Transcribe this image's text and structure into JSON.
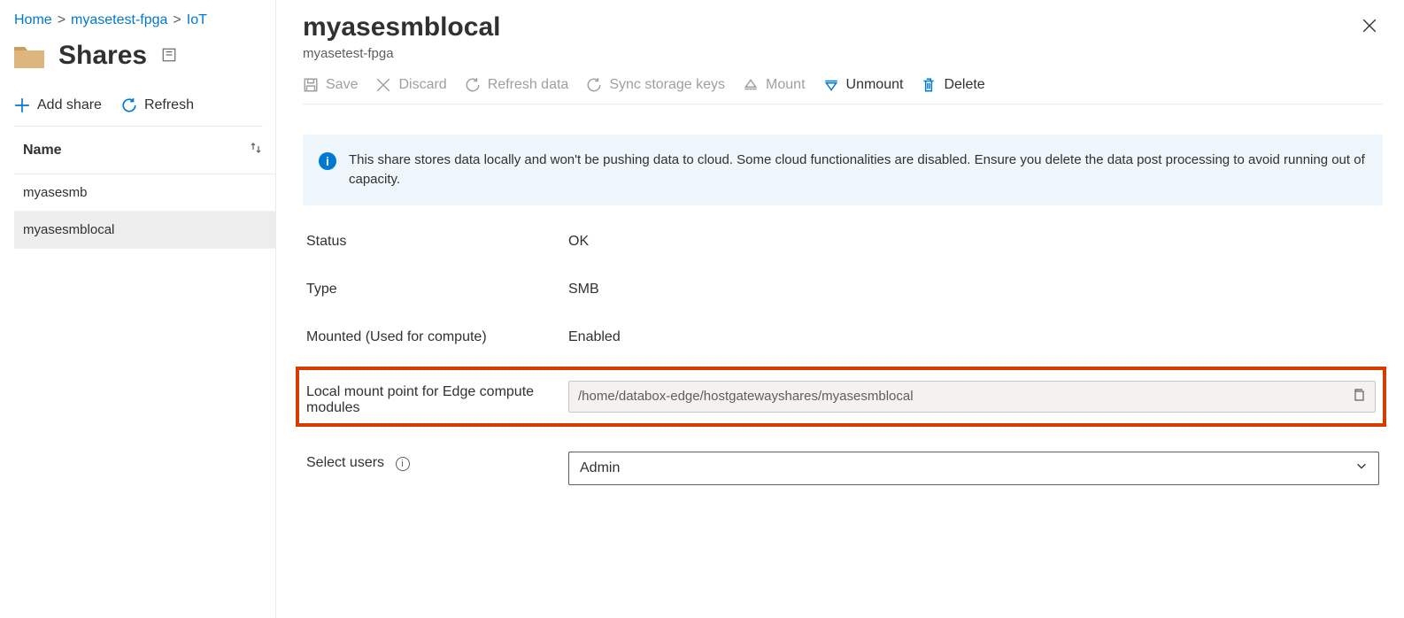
{
  "breadcrumb": {
    "home": "Home",
    "resource": "myasetest-fpga",
    "tail": "IoT"
  },
  "leftPane": {
    "title": "Shares",
    "addShare": "Add share",
    "refresh": "Refresh",
    "columnHeader": "Name",
    "rows": [
      {
        "name": "myasesmb",
        "selected": false
      },
      {
        "name": "myasesmblocal",
        "selected": true
      }
    ]
  },
  "detail": {
    "title": "myasesmblocal",
    "subtitle": "myasetest-fpga",
    "cmds": {
      "save": "Save",
      "discard": "Discard",
      "refreshData": "Refresh data",
      "syncKeys": "Sync storage keys",
      "mount": "Mount",
      "unmount": "Unmount",
      "delete": "Delete"
    },
    "banner": "This share stores data locally and won't be pushing data to cloud. Some cloud functionalities are disabled. Ensure you delete the data post processing to avoid running out of capacity.",
    "fields": {
      "statusLabel": "Status",
      "statusValue": "OK",
      "typeLabel": "Type",
      "typeValue": "SMB",
      "mountedLabel": "Mounted (Used for compute)",
      "mountedValue": "Enabled",
      "mountPointLabel": "Local mount point for Edge compute modules",
      "mountPointValue": "/home/databox-edge/hostgatewayshares/myasesmblocal",
      "selectUsersLabel": "Select users",
      "selectUsersValue": "Admin"
    }
  }
}
